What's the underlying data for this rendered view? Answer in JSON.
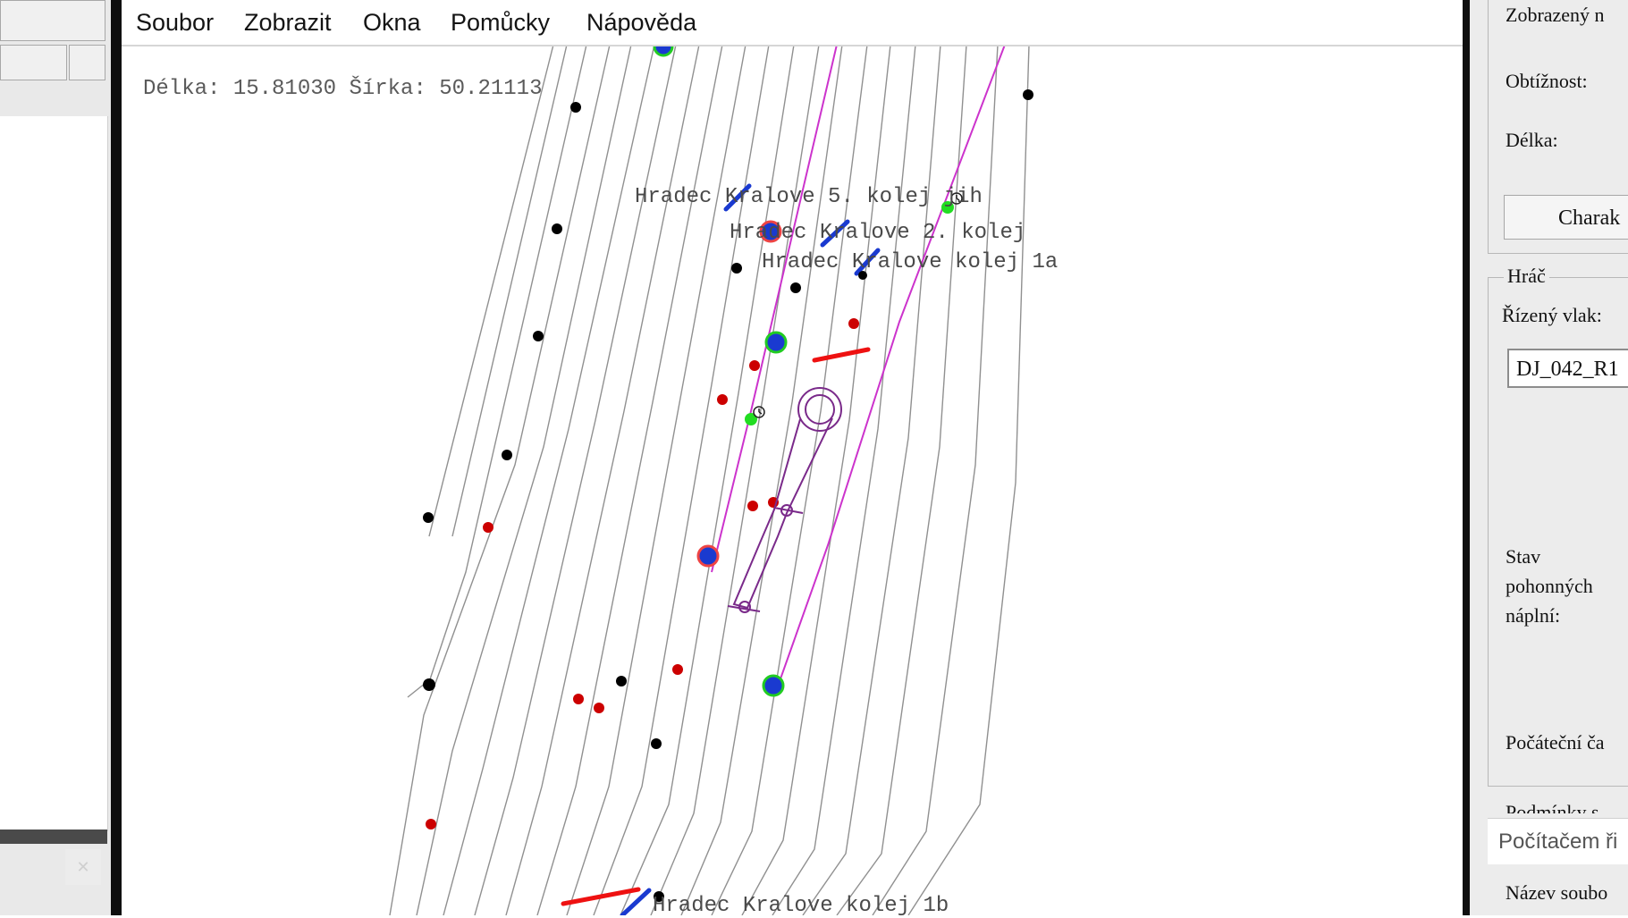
{
  "menu": [
    "Soubor",
    "Zobrazit",
    "Okna",
    "Pomůcky",
    "Nápověda"
  ],
  "map": {
    "coords": "Délka: 15.81030 Šírka: 50.21113",
    "labels": [
      "Hradec Kralove 5. kolej jih",
      "Hradec Kralove 2. kolej",
      "Hradec Kralove kolej 1a",
      "Hradec Kralove kolej 1b"
    ]
  },
  "right_panel": {
    "displayed_label": "Zobrazený n",
    "difficulty_label": "Obtížnost:",
    "length_label": "Délka:",
    "characteristics_button": "Charak",
    "player_legend": "Hráč",
    "controlled_train_label": "Řízený vlak:",
    "controlled_train_value": "DJ_042_R1",
    "fuel_label_1": "Stav",
    "fuel_label_2": "pohonných",
    "fuel_label_3": "náplní:",
    "start_time_label": "Počáteční ča",
    "conditions_label": "Podmínky s",
    "computer_controlled": "Počítačem ři",
    "file_name_label": "Název soubo"
  },
  "colors": {
    "track": "#909090",
    "path": "#cc33cc",
    "train": "#7a2a8a",
    "signal_blue": "#1a3ad0",
    "signal_red": "#ee1111",
    "dot_black": "#000000",
    "dot_red": "#cc0000",
    "dot_green": "#22dd22"
  }
}
